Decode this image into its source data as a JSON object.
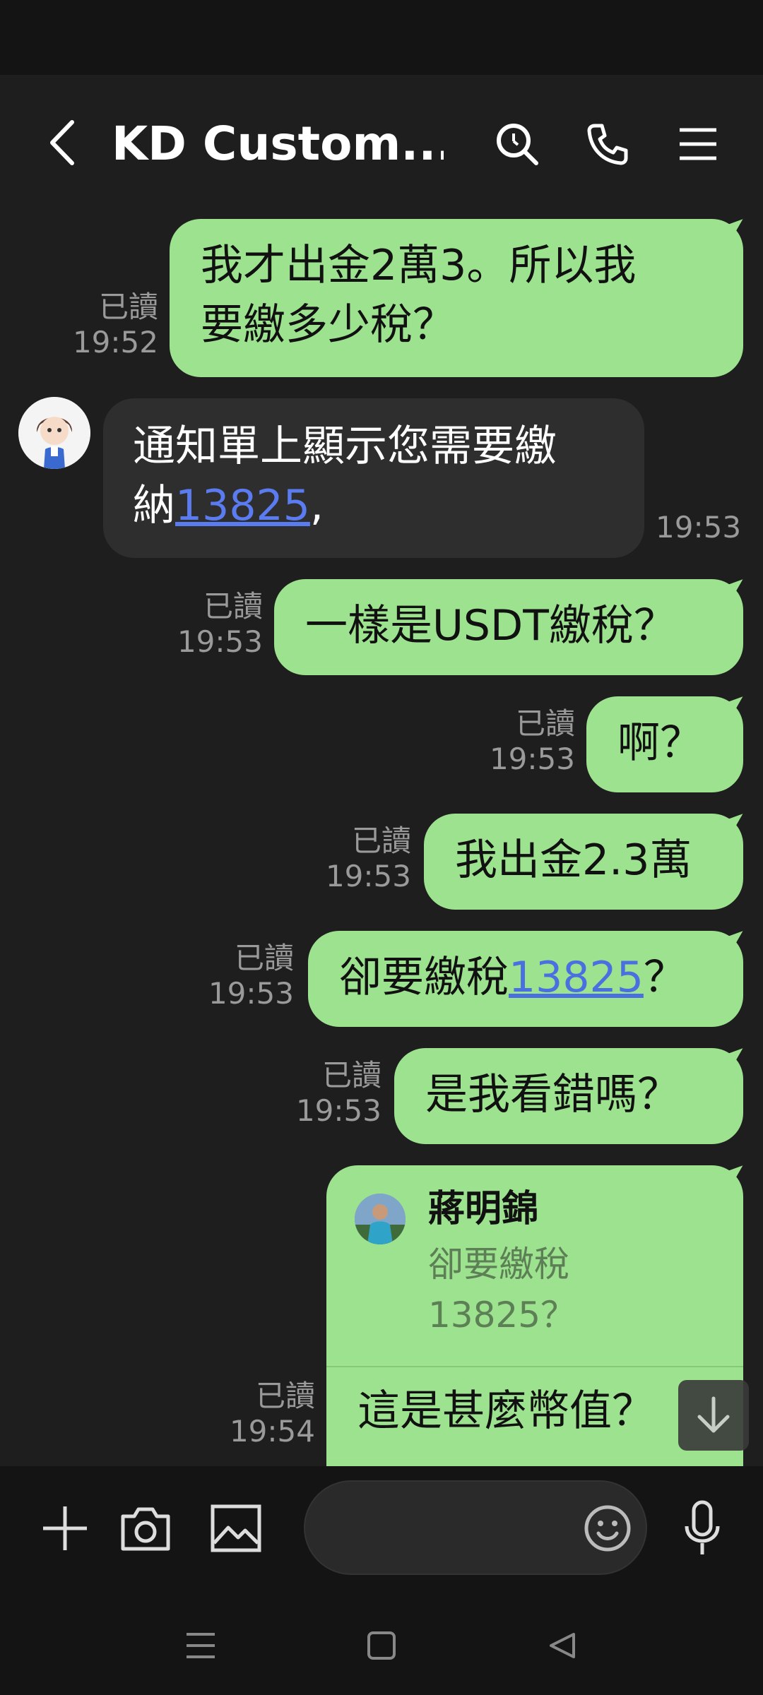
{
  "header": {
    "title": "KD Custom..."
  },
  "messages": [
    {
      "dir": "sent",
      "read": "已讀",
      "time": "19:52",
      "lines": [
        "我才出金2萬3。所以我",
        "要繳多少稅？"
      ]
    },
    {
      "dir": "recv",
      "time": "19:53",
      "line1": "通知單上顯示您需要繳",
      "line2_pre": "納",
      "line2_link": "13825",
      "line2_post": ","
    },
    {
      "dir": "sent",
      "read": "已讀",
      "time": "19:53",
      "text": "一樣是USDT繳稅？"
    },
    {
      "dir": "sent",
      "read": "已讀",
      "time": "19:53",
      "text": "啊？"
    },
    {
      "dir": "sent",
      "read": "已讀",
      "time": "19:53",
      "text": "我出金2.3萬"
    },
    {
      "dir": "sent",
      "read": "已讀",
      "time": "19:53",
      "pre": "卻要繳稅",
      "link": "13825",
      "post": "？"
    },
    {
      "dir": "sent",
      "read": "已讀",
      "time": "19:53",
      "text": "是我看錯嗎？"
    },
    {
      "dir": "sent",
      "read": "已讀",
      "time": "19:54",
      "reply_name": "蔣明錦",
      "reply_quote_1": "卻要繳稅",
      "reply_quote_2": "13825？",
      "text": "這是甚麼幣值？"
    }
  ],
  "colors": {
    "sent_bubble": "#9de28f",
    "recv_bubble": "#2e2e2e",
    "link": "#4a6fe0",
    "background": "#1e1e1e"
  },
  "icons": [
    "back-icon",
    "search-icon",
    "phone-icon",
    "menu-icon",
    "plus-icon",
    "camera-icon",
    "image-icon",
    "emoji-icon",
    "mic-icon",
    "arrow-down-icon",
    "nav-recents-icon",
    "nav-home-icon",
    "nav-back-icon"
  ]
}
